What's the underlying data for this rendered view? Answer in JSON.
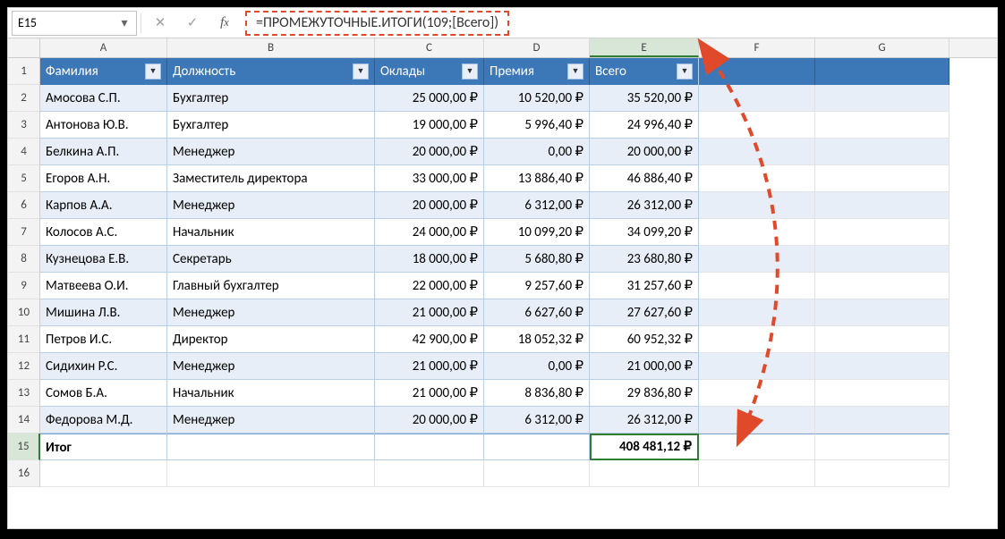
{
  "cellRef": "E15",
  "formula": "=ПРОМЕЖУТОЧНЫЕ.ИТОГИ(109;[Всего])",
  "columns": [
    "A",
    "B",
    "C",
    "D",
    "E",
    "F",
    "G"
  ],
  "headers": {
    "A": "Фамилия",
    "B": "Должность",
    "C": "Оклады",
    "D": "Премия",
    "E": "Всего"
  },
  "rows": [
    {
      "n": 2,
      "A": "Амосова С.П.",
      "B": "Бухгалтер",
      "C": "25 000,00 ₽",
      "D": "10 520,00 ₽",
      "E": "35 520,00 ₽"
    },
    {
      "n": 3,
      "A": "Антонова Ю.В.",
      "B": "Бухгалтер",
      "C": "19 000,00 ₽",
      "D": "5 996,40 ₽",
      "E": "24 996,40 ₽"
    },
    {
      "n": 4,
      "A": "Белкина А.П.",
      "B": "Менеджер",
      "C": "20 000,00 ₽",
      "D": "0,00 ₽",
      "E": "20 000,00 ₽"
    },
    {
      "n": 5,
      "A": "Егоров А.Н.",
      "B": "Заместитель директора",
      "C": "33 000,00 ₽",
      "D": "13 886,40 ₽",
      "E": "46 886,40 ₽"
    },
    {
      "n": 6,
      "A": "Карпов А.А.",
      "B": "Менеджер",
      "C": "20 000,00 ₽",
      "D": "6 312,00 ₽",
      "E": "26 312,00 ₽"
    },
    {
      "n": 7,
      "A": "Колосов А.С.",
      "B": "Начальник",
      "C": "24 000,00 ₽",
      "D": "10 099,20 ₽",
      "E": "34 099,20 ₽"
    },
    {
      "n": 8,
      "A": "Кузнецова Е.В.",
      "B": "Секретарь",
      "C": "18 000,00 ₽",
      "D": "5 680,80 ₽",
      "E": "23 680,80 ₽"
    },
    {
      "n": 9,
      "A": "Матвеева О.И.",
      "B": "Главный бухгалтер",
      "C": "22 000,00 ₽",
      "D": "9 257,60 ₽",
      "E": "31 257,60 ₽"
    },
    {
      "n": 10,
      "A": "Мишина Л.В.",
      "B": "Менеджер",
      "C": "21 000,00 ₽",
      "D": "6 627,60 ₽",
      "E": "27 627,60 ₽"
    },
    {
      "n": 11,
      "A": "Петров И.С.",
      "B": "Директор",
      "C": "42 900,00 ₽",
      "D": "18 052,32 ₽",
      "E": "60 952,32 ₽"
    },
    {
      "n": 12,
      "A": "Сидихин Р.С.",
      "B": "Менеджер",
      "C": "21 000,00 ₽",
      "D": "0,00 ₽",
      "E": "21 000,00 ₽"
    },
    {
      "n": 13,
      "A": "Сомов Б.А.",
      "B": "Начальник",
      "C": "21 000,00 ₽",
      "D": "8 836,80 ₽",
      "E": "29 836,80 ₽"
    },
    {
      "n": 14,
      "A": "Федорова М.Д.",
      "B": "Менеджер",
      "C": "20 000,00 ₽",
      "D": "6 312,00 ₽",
      "E": "26 312,00 ₽"
    }
  ],
  "total": {
    "n": 15,
    "label": "Итог",
    "value": "408 481,12 ₽"
  },
  "blankRow": 16
}
